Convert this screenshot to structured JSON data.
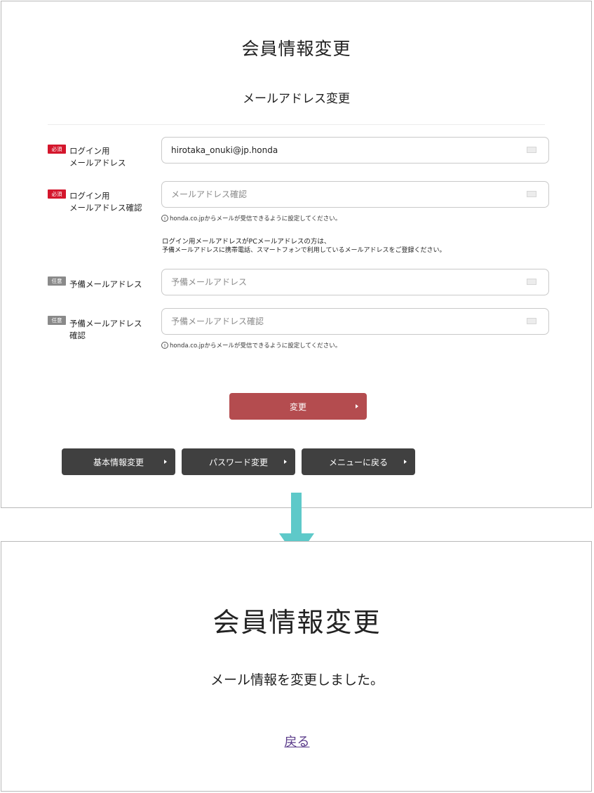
{
  "top": {
    "title": "会員情報変更",
    "subtitle": "メールアドレス変更",
    "fields": [
      {
        "badge": "必須",
        "badge_type": "required",
        "label_lines": [
          "ログイン用",
          "メールアドレス"
        ],
        "value": "hirotaka_onuki@jp.honda",
        "placeholder": ""
      },
      {
        "badge": "必須",
        "badge_type": "required",
        "label_lines": [
          "ログイン用",
          "メールアドレス確認"
        ],
        "value": "",
        "placeholder": "メールアドレス確認"
      },
      {
        "badge": "任意",
        "badge_type": "optional",
        "label_lines": [
          "予備メールアドレス"
        ],
        "value": "",
        "placeholder": "予備メールアドレス"
      },
      {
        "badge": "任意",
        "badge_type": "optional",
        "label_lines": [
          "予備メールアドレス",
          "確認"
        ],
        "value": "",
        "placeholder": "予備メールアドレス確認"
      }
    ],
    "note_text": "honda.co.jpからメールが受信できるように設定してください。",
    "info_lines": [
      "ログイン用メールアドレスがPCメールアドレスの方は、",
      "予備メールアドレスに携帯電話、スマートフォンで利用しているメールアドレスをご登録ください。"
    ],
    "submit_label": "変更",
    "nav_buttons": [
      "基本情報変更",
      "パスワード変更",
      "メニューに戻る"
    ]
  },
  "bottom": {
    "title": "会員情報変更",
    "message": "メール情報を変更しました。",
    "back_link": "戻る"
  },
  "colors": {
    "required_badge": "#d4162c",
    "optional_badge": "#8a8a8a",
    "submit_button": "#b44c4f",
    "nav_button": "#404040",
    "arrow": "#5ec9c9",
    "link": "#5a3b8a"
  },
  "icons": {
    "field_icon": "mail-icon",
    "note_icon": "exclamation-circle-icon",
    "button_icon": "chevron-right-icon",
    "transition_icon": "arrow-down-icon"
  }
}
